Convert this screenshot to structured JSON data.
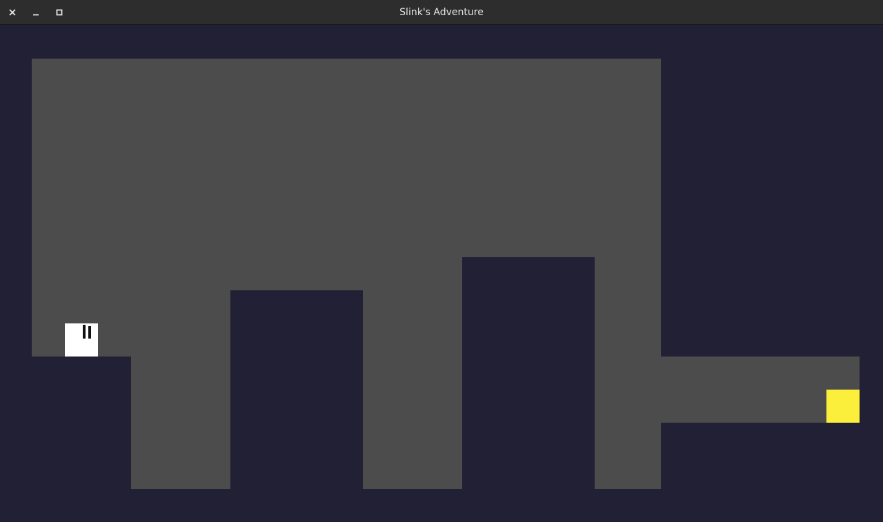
{
  "window": {
    "title": "Slink's Adventure",
    "controls": [
      {
        "name": "close",
        "icon": "close-icon"
      },
      {
        "name": "minimize",
        "icon": "minimize-icon"
      },
      {
        "name": "maximize",
        "icon": "maximize-icon"
      }
    ]
  },
  "game": {
    "colors": {
      "background": "#222035",
      "wall": "#4c4c4c",
      "player": "#ffffff",
      "goal": "#fbef3b"
    },
    "entities": [
      "player",
      "goal"
    ]
  }
}
